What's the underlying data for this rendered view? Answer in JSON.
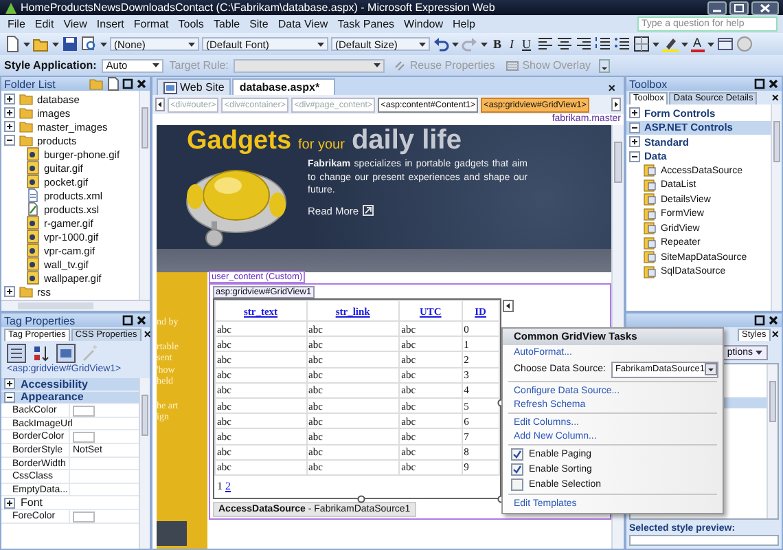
{
  "window": {
    "title": "HomeProductsNewsDownloadsContact (C:\\Fabrikam\\database.aspx) - Microsoft Expression Web"
  },
  "menu": [
    "File",
    "Edit",
    "View",
    "Insert",
    "Format",
    "Tools",
    "Table",
    "Site",
    "Data View",
    "Task Panes",
    "Window",
    "Help"
  ],
  "help_search": {
    "placeholder": "Type a question for help"
  },
  "toolbar": {
    "style_select": "(None)",
    "font_select": "(Default Font)",
    "size_select": "(Default Size)",
    "format_buttons": [
      "B",
      "I",
      "U"
    ],
    "font_color": "A"
  },
  "style_toolbar": {
    "style_application_label": "Style Application:",
    "style_application_value": "Auto",
    "target_rule": {
      "label": "Target Rule:",
      "disabled": true
    },
    "reuse_properties": {
      "label": "Reuse Properties",
      "disabled": true
    },
    "show_overlay": {
      "label": "Show Overlay",
      "disabled": true
    }
  },
  "folder_list": {
    "title": "Folder List",
    "items": [
      {
        "kind": "folder",
        "label": "database",
        "expanded": false
      },
      {
        "kind": "folder",
        "label": "images",
        "expanded": false
      },
      {
        "kind": "folder",
        "label": "master_images",
        "expanded": false
      },
      {
        "kind": "folder",
        "label": "products",
        "expanded": true,
        "children": [
          {
            "kind": "image",
            "label": "burger-phone.gif"
          },
          {
            "kind": "image",
            "label": "guitar.gif"
          },
          {
            "kind": "image",
            "label": "pocket.gif"
          },
          {
            "kind": "xml",
            "label": "products.xml"
          },
          {
            "kind": "xsl",
            "label": "products.xsl"
          },
          {
            "kind": "image",
            "label": "r-gamer.gif"
          },
          {
            "kind": "image",
            "label": "vpr-1000.gif"
          },
          {
            "kind": "image",
            "label": "vpr-cam.gif"
          },
          {
            "kind": "image",
            "label": "wall_tv.gif"
          },
          {
            "kind": "image",
            "label": "wallpaper.gif"
          }
        ]
      },
      {
        "kind": "folder",
        "label": "rss",
        "expanded": false
      }
    ]
  },
  "tag_properties": {
    "title": "Tag Properties",
    "tabs": [
      {
        "label": "Tag Properties",
        "selected": true
      },
      {
        "label": "CSS Properties",
        "selected": false
      }
    ],
    "close": "×",
    "tag": "<asp:gridview#GridView1>",
    "properties": [
      {
        "kind": "category",
        "label": "Accessibility",
        "expanded": false
      },
      {
        "kind": "category",
        "label": "Appearance",
        "expanded": true
      },
      {
        "kind": "color",
        "label": "BackColor"
      },
      {
        "kind": "property",
        "label": "BackImageUrl"
      },
      {
        "kind": "color",
        "label": "BorderColor"
      },
      {
        "kind": "property",
        "label": "BorderStyle",
        "value": "NotSet"
      },
      {
        "kind": "property",
        "label": "BorderWidth"
      },
      {
        "kind": "property",
        "label": "CssClass"
      },
      {
        "kind": "property",
        "label": "EmptyData..."
      },
      {
        "kind": "group",
        "label": "Font",
        "expanded": false
      },
      {
        "kind": "color",
        "label": "ForeColor"
      }
    ]
  },
  "editor": {
    "tabs": [
      {
        "label": "Web Site",
        "selected": false
      },
      {
        "label": "database.aspx*",
        "selected": true
      }
    ],
    "close": "×",
    "breadcrumbs": [
      {
        "label": "<div#outer>",
        "dimmed": true,
        "selected": false
      },
      {
        "label": "<div#container>",
        "dimmed": true,
        "selected": false
      },
      {
        "label": "<div#page_content>",
        "dimmed": true,
        "selected": false
      },
      {
        "label": "<asp:content#Content1>",
        "dimmed": false,
        "selected": false
      },
      {
        "label": "<asp:gridview#GridView1>",
        "dimmed": false,
        "selected": true
      }
    ],
    "master": "fabrikam.master",
    "banner": {
      "heading_1": "Gadgets",
      "heading_2": "for your",
      "heading_3": "daily life",
      "text": "**Fabrikam** specializes in portable gadgets that aim to change our present experiences and shape our future.",
      "link": "Read More"
    },
    "sidebar_fragments": [
      "nd by",
      "rtable",
      "sent",
      "'how",
      "held",
      "he art",
      "ign"
    ],
    "region_label": "user_content (Custom)",
    "grid_label": "asp:gridview#GridView1",
    "grid": {
      "columns": [
        "str_text",
        "str_link",
        "UTC",
        "ID"
      ],
      "rows": [
        [
          "abc",
          "abc",
          "abc",
          "0"
        ],
        [
          "abc",
          "abc",
          "abc",
          "1"
        ],
        [
          "abc",
          "abc",
          "abc",
          "2"
        ],
        [
          "abc",
          "abc",
          "abc",
          "3"
        ],
        [
          "abc",
          "abc",
          "abc",
          "4"
        ],
        [
          "abc",
          "abc",
          "abc",
          "5"
        ],
        [
          "abc",
          "abc",
          "abc",
          "6"
        ],
        [
          "abc",
          "abc",
          "abc",
          "7"
        ],
        [
          "abc",
          "abc",
          "abc",
          "8"
        ],
        [
          "abc",
          "abc",
          "abc",
          "9"
        ]
      ],
      "pager": [
        {
          "label": "1",
          "selected": true
        },
        {
          "label": "2",
          "selected": false
        }
      ]
    },
    "datasource": "**AccessDataSource** - FabrikamDataSource1"
  },
  "tasks": {
    "title": "Common GridView Tasks",
    "items": [
      {
        "kind": "link",
        "label": "AutoFormat..."
      },
      {
        "kind": "select",
        "label": "Choose Data Source:",
        "value": "FabrikamDataSource1"
      },
      {
        "kind": "separator"
      },
      {
        "kind": "link",
        "label": "Configure Data Source..."
      },
      {
        "kind": "link",
        "label": "Refresh Schema"
      },
      {
        "kind": "separator"
      },
      {
        "kind": "link",
        "label": "Edit Columns..."
      },
      {
        "kind": "link",
        "label": "Add New Column..."
      },
      {
        "kind": "separator"
      },
      {
        "kind": "check",
        "label": "Enable Paging",
        "checked": true
      },
      {
        "kind": "check",
        "label": "Enable Sorting",
        "checked": true
      },
      {
        "kind": "check",
        "label": "Enable Selection",
        "checked": false
      },
      {
        "kind": "separator"
      },
      {
        "kind": "link",
        "label": "Edit Templates"
      }
    ]
  },
  "toolbox": {
    "title": "Toolbox",
    "tabs": [
      {
        "label": "Toolbox",
        "selected": true
      },
      {
        "label": "Data Source Details",
        "selected": false
      }
    ],
    "close": "×",
    "items": [
      {
        "kind": "category",
        "label": "Form Controls",
        "expanded": false,
        "selected": false
      },
      {
        "kind": "category",
        "label": "ASP.NET Controls",
        "expanded": true,
        "selected": true
      },
      {
        "kind": "category",
        "label": "Standard",
        "expanded": false,
        "selected": false
      },
      {
        "kind": "category",
        "label": "Data",
        "expanded": true,
        "selected": false,
        "children": [
          {
            "label": "AccessDataSource",
            "selected": false
          },
          {
            "label": "DataList",
            "selected": false
          },
          {
            "label": "DetailsView",
            "selected": false
          },
          {
            "label": "FormView",
            "selected": false
          },
          {
            "label": "GridView",
            "selected": false
          },
          {
            "label": "Repeater",
            "selected": false
          },
          {
            "label": "SiteMapDataSource",
            "selected": false
          },
          {
            "label": "SqlDataSource",
            "selected": false
          }
        ]
      }
    ]
  },
  "styles_panel": {
    "tab": "Styles",
    "close": "×",
    "options_button": "ptions",
    "preview_label": "Selected style preview:"
  }
}
